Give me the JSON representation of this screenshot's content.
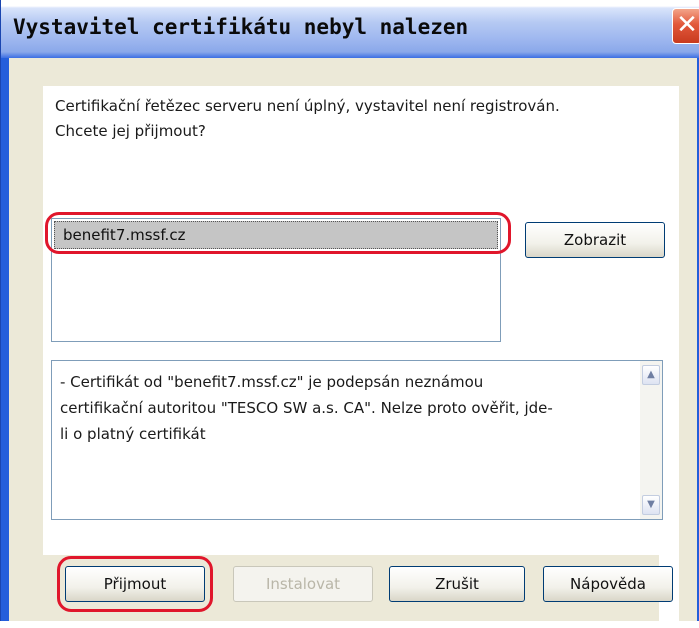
{
  "dialog": {
    "title": "Vystavitel certifikátu nebyl nalezen",
    "close_glyph": "✕"
  },
  "message": {
    "line1": "Certifikační řetězec serveru není úplný, vystavitel není registrován.",
    "line2": "Chcete jej přijmout?"
  },
  "certificate_list": {
    "items": [
      {
        "label": "benefit7.mssf.cz",
        "selected": true
      }
    ]
  },
  "buttons": {
    "view": "Zobrazit",
    "accept": "Přijmout",
    "install": "Instalovat",
    "cancel": "Zrušit",
    "help": "Nápověda"
  },
  "details": {
    "line1": "- Certifikát od \"benefit7.mssf.cz\" je podepsán neznámou",
    "line2": "certifikační autoritou \"TESCO SW a.s. CA\". Nelze proto ověřit, jde-",
    "line3": "li o platný certifikát"
  },
  "icons": {
    "scroll_up": "▲",
    "scroll_down": "▼"
  },
  "colors": {
    "title_bar": "#9db6ef",
    "window_frame": "#245edb",
    "dialog_background": "#ece9d8",
    "highlight_annotation": "#e0162b",
    "selection": "#c5c5c5"
  }
}
